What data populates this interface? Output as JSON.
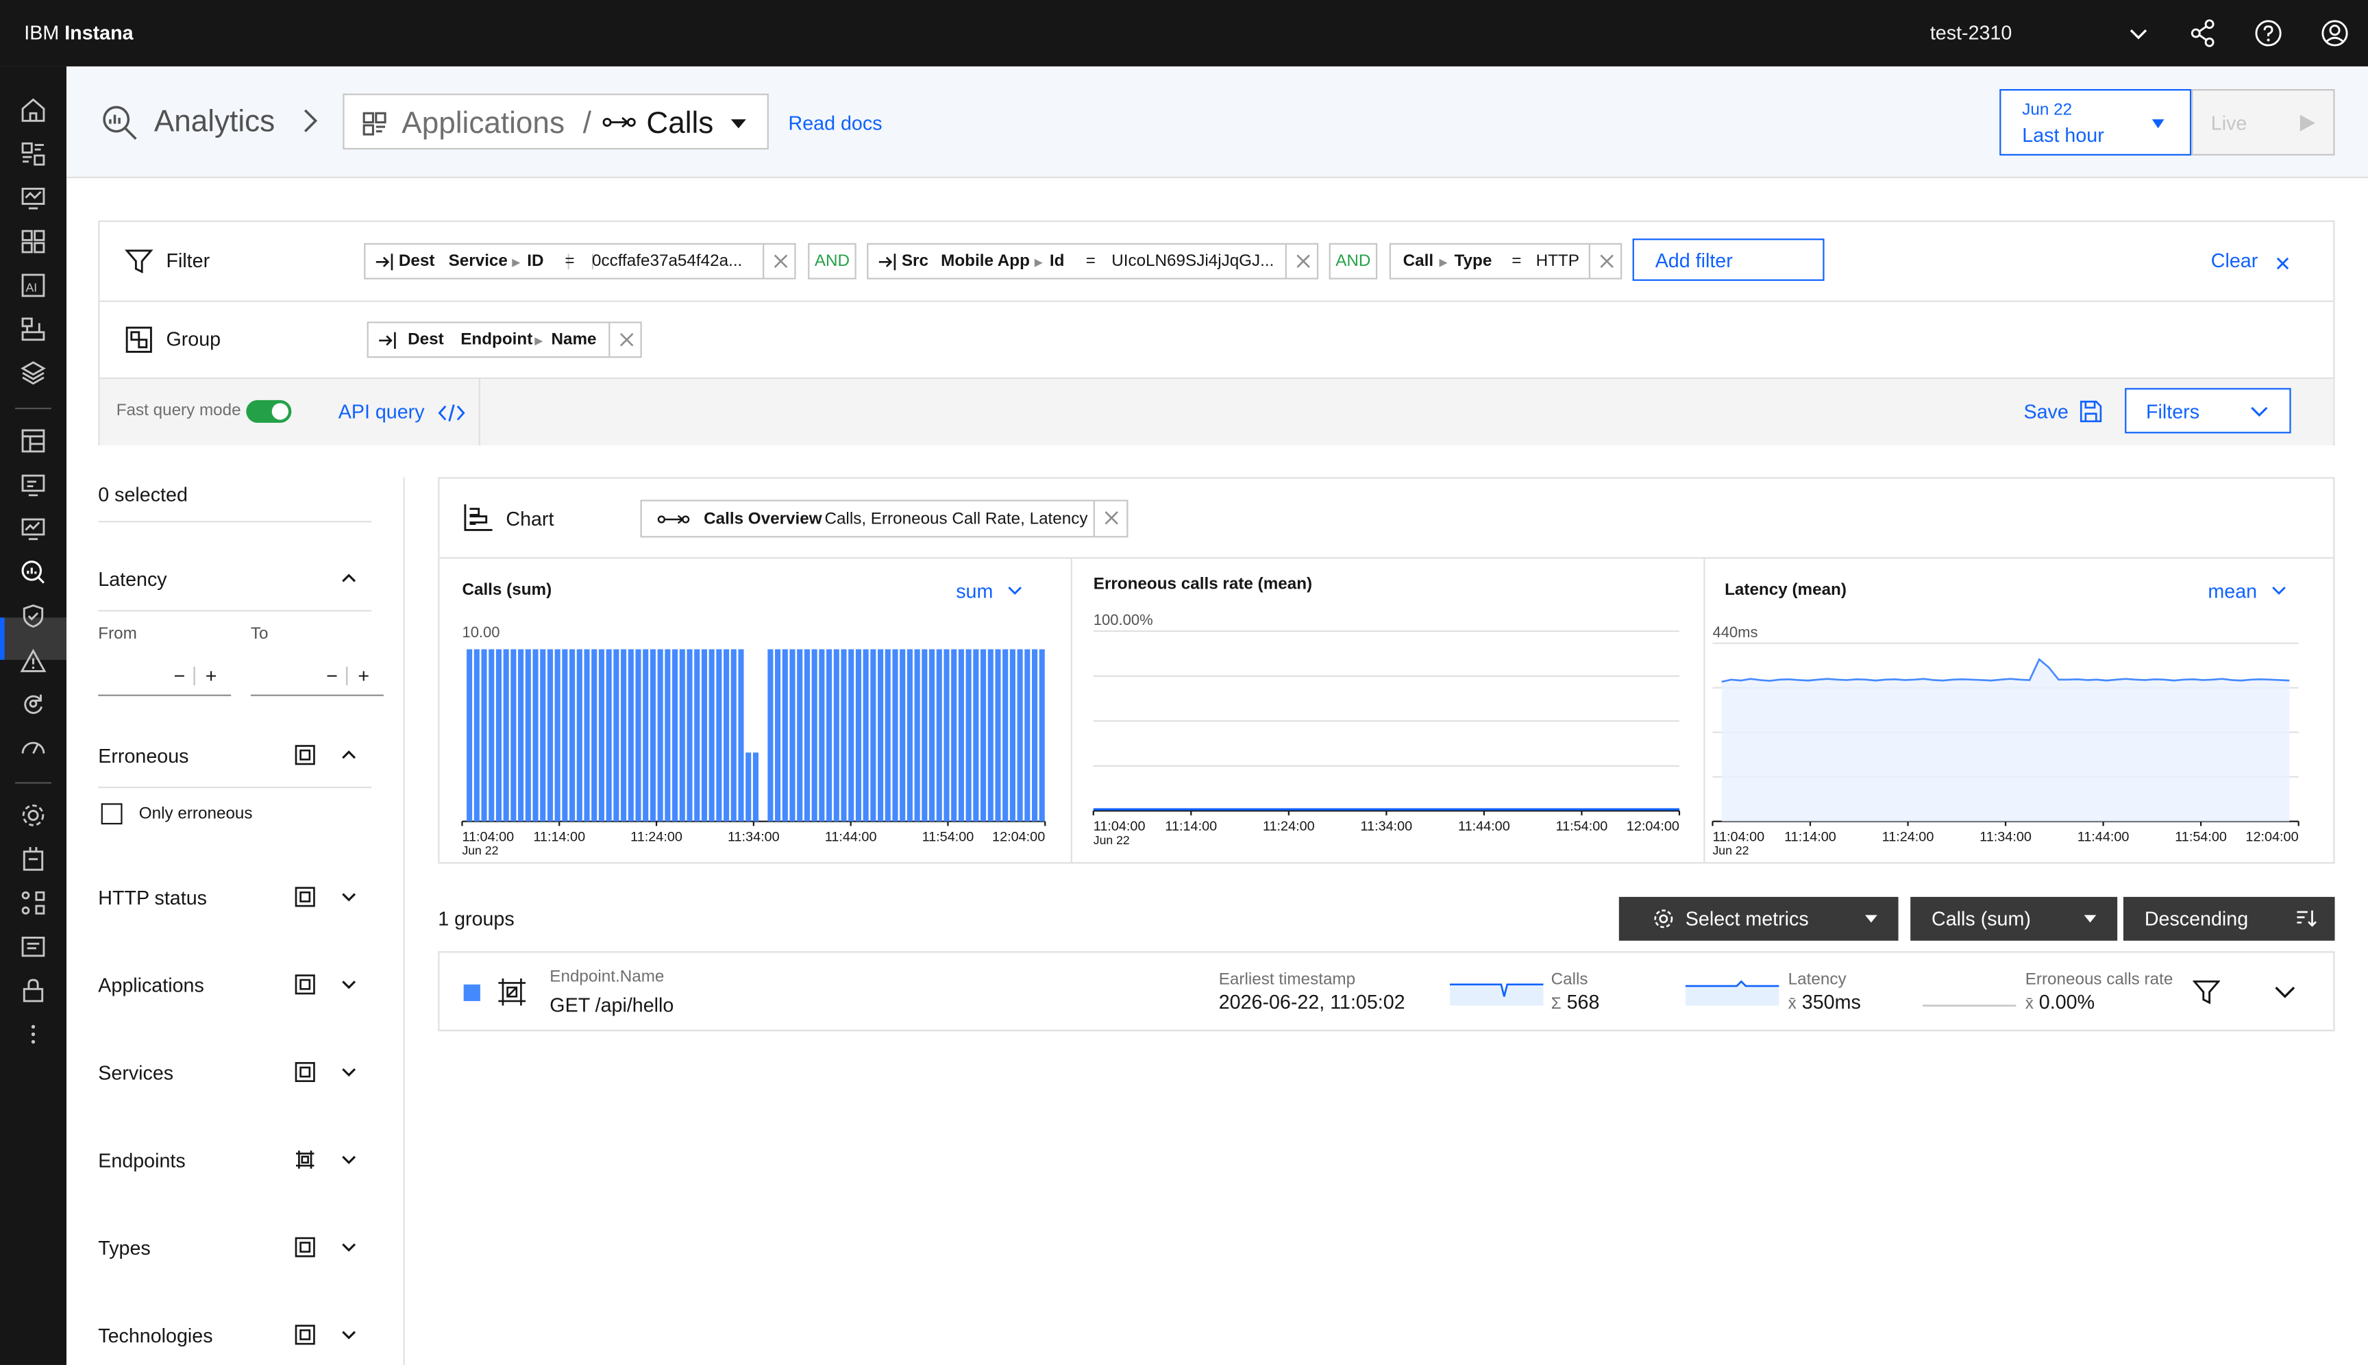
{
  "topbar": {
    "brand_prefix": "IBM",
    "brand_name": "Instana",
    "tenant": "test-2310"
  },
  "header": {
    "section": "Analytics",
    "selector_scope": "Applications",
    "selector_separator": "/",
    "selector_entity": "Calls",
    "read_docs": "Read docs",
    "date_day": "Jun 22",
    "date_range": "Last hour",
    "live": "Live"
  },
  "filter_bar": {
    "filter_label": "Filter",
    "group_label": "Group",
    "filters": [
      {
        "direction": "Dest",
        "entity": "Service",
        "field": "ID",
        "op": "=",
        "value": "0ccffafe37a54f42a..."
      },
      {
        "direction": "Src",
        "entity": "Mobile App",
        "field": "Id",
        "op": "=",
        "value": "UIcoLN69SJi4jJqGJ..."
      },
      {
        "direction": "",
        "entity": "Call",
        "field": "Type",
        "op": "=",
        "value": "HTTP"
      }
    ],
    "and_label": "AND",
    "add_filter": "Add filter",
    "clear": "Clear",
    "group": {
      "direction": "Dest",
      "entity": "Endpoint",
      "field": "Name"
    },
    "fast_query_mode": "Fast query mode",
    "api_query": "API query",
    "save": "Save",
    "filters_button": "Filters"
  },
  "sidebar": {
    "selected": "0 selected",
    "latency": "Latency",
    "from": "From",
    "to": "To",
    "minus": "−",
    "plus": "+",
    "erroneous": "Erroneous",
    "only_erroneous": "Only erroneous",
    "sections": [
      "HTTP status",
      "Applications",
      "Services",
      "Endpoints",
      "Types",
      "Technologies"
    ]
  },
  "chart_panel": {
    "label": "Chart",
    "chip_name": "Calls Overview",
    "chip_metrics": "Calls, Erroneous Call Rate, Latency"
  },
  "chart_data": [
    {
      "type": "bar",
      "title": "Calls (sum)",
      "aggregation": "sum",
      "ymax_label": "10.00",
      "ylim": [
        0,
        10
      ],
      "x_ticks": [
        "11:04:00",
        "11:14:00",
        "11:24:00",
        "11:34:00",
        "11:44:00",
        "11:54:00",
        "12:04:00"
      ],
      "x_date": "Jun 22",
      "values": [
        10,
        10,
        10,
        10,
        10,
        10,
        10,
        10,
        10,
        10,
        10,
        10,
        10,
        10,
        10,
        10,
        10,
        10,
        10,
        10,
        10,
        10,
        10,
        10,
        10,
        10,
        10,
        10,
        10,
        10,
        10,
        10,
        10,
        10,
        10,
        10,
        10,
        10,
        4,
        4,
        0,
        10,
        10,
        10,
        10,
        10,
        10,
        10,
        10,
        10,
        10,
        10,
        10,
        10,
        10,
        10,
        10,
        10,
        10,
        10,
        10,
        10,
        10,
        10,
        10,
        10,
        10,
        10,
        10,
        10,
        10,
        10,
        10,
        10,
        10,
        10,
        10,
        10,
        10
      ]
    },
    {
      "type": "line",
      "title": "Erroneous calls rate (mean)",
      "ymax_label": "100.00%",
      "ylim": [
        0,
        100
      ],
      "x_ticks": [
        "11:04:00",
        "11:14:00",
        "11:24:00",
        "11:34:00",
        "11:44:00",
        "11:54:00",
        "12:04:00"
      ],
      "x_date": "Jun 22",
      "values": [
        0,
        0,
        0,
        0,
        0,
        0,
        0,
        0,
        0,
        0,
        0,
        0,
        0,
        0,
        0,
        0,
        0,
        0,
        0,
        0,
        0,
        0,
        0,
        0,
        0,
        0,
        0,
        0,
        0,
        0,
        0,
        0,
        0,
        0,
        0,
        0,
        0,
        0,
        0,
        0,
        0,
        0,
        0,
        0,
        0,
        0,
        0,
        0,
        0,
        0,
        0,
        0,
        0,
        0,
        0,
        0,
        0,
        0,
        0,
        0
      ]
    },
    {
      "type": "area",
      "title": "Latency (mean)",
      "aggregation": "mean",
      "ymax_label": "440ms",
      "ylim": [
        0,
        440
      ],
      "x_ticks": [
        "11:04:00",
        "11:14:00",
        "11:24:00",
        "11:34:00",
        "11:44:00",
        "11:54:00",
        "12:04:00"
      ],
      "x_date": "Jun 22",
      "values": [
        345,
        350,
        348,
        352,
        349,
        347,
        350,
        351,
        349,
        348,
        350,
        352,
        350,
        349,
        351,
        350,
        348,
        350,
        351,
        349,
        350,
        352,
        349,
        348,
        350,
        351,
        350,
        349,
        348,
        350,
        352,
        350,
        349,
        400,
        380,
        350,
        350,
        351,
        349,
        350,
        348,
        350,
        352,
        350,
        349,
        351,
        350,
        348,
        350,
        351,
        349,
        350,
        352,
        349,
        348,
        350,
        351,
        350,
        349,
        348
      ]
    }
  ],
  "results": {
    "groups_count": "1 groups",
    "select_metrics": "Select metrics",
    "sort_metric": "Calls (sum)",
    "sort_order": "Descending",
    "row": {
      "field_label": "Endpoint.Name",
      "field_value": "GET /api/hello",
      "earliest_label": "Earliest timestamp",
      "earliest_value": "2026-06-22, 11:05:02",
      "calls_label": "Calls",
      "calls_value": "568",
      "latency_label": "Latency",
      "latency_value": "350ms",
      "err_label": "Erroneous calls rate",
      "err_value": "0.00%",
      "sum_symbol": "Σ",
      "mean_symbol": "x̄"
    }
  }
}
